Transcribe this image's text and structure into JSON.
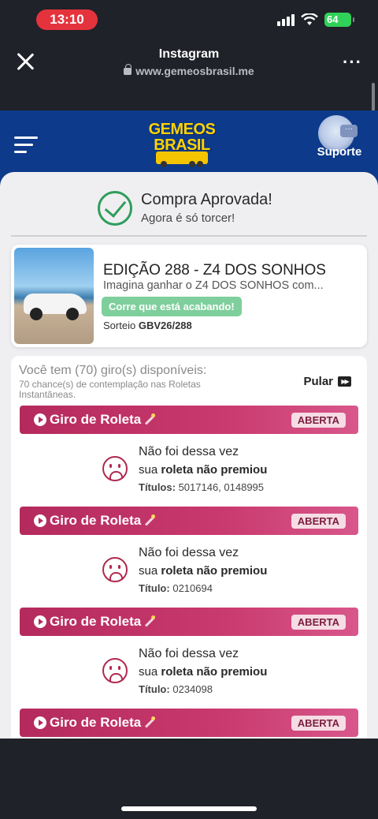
{
  "status_bar": {
    "time": "13:10",
    "battery": "64"
  },
  "browser": {
    "title": "Instagram",
    "url": "www.gemeosbrasil.me"
  },
  "header": {
    "logo_text_line1": "GEMEOS",
    "logo_text_line2": "BRASIL",
    "support_label": "Suporte"
  },
  "approval": {
    "title": "Compra Aprovada!",
    "subtitle": "Agora é só torcer!"
  },
  "product": {
    "title": "EDIÇÃO 288 - Z4 DOS SONHOS",
    "description": "Imagina ganhar o Z4 DOS SONHOS com...",
    "badge": "Corre que está acabando!",
    "draw_label": "Sorteio",
    "draw_code": "GBV26/288"
  },
  "spins": {
    "title": "Você tem (70) giro(s) disponíveis:",
    "subtitle": "70 chance(s) de contemplação nas Roletas Instantâneas.",
    "skip_label": "Pular",
    "items": [
      {
        "label": "Giro de Roleta",
        "status": "ABERTA",
        "line1": "Não foi dessa vez",
        "line2_prefix": "sua",
        "line2_bold": "roleta não premiou",
        "titles_label": "Títulos:",
        "titles_value": "5017146, 0148995"
      },
      {
        "label": "Giro de Roleta",
        "status": "ABERTA",
        "line1": "Não foi dessa vez",
        "line2_prefix": "sua",
        "line2_bold": "roleta não premiou",
        "titles_label": "Título:",
        "titles_value": "0210694"
      },
      {
        "label": "Giro de Roleta",
        "status": "ABERTA",
        "line1": "Não foi dessa vez",
        "line2_prefix": "sua",
        "line2_bold": "roleta não premiou",
        "titles_label": "Título:",
        "titles_value": "0234098"
      },
      {
        "label": "Giro de Roleta",
        "status": "ABERTA"
      }
    ]
  },
  "colors": {
    "header_blue": "#0d3a8a",
    "accent_magenta": "#b42a5c",
    "success_green": "#2e9d5c",
    "badge_green": "#7fcf9c"
  }
}
